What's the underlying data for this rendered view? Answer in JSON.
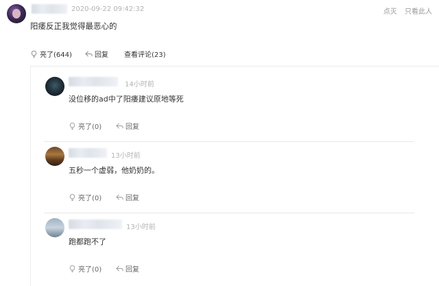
{
  "main_comment": {
    "time": "2020-09-22 09:42:32",
    "text": "阳痿反正我觉得最恶心的",
    "actions": {
      "like": "亮了(644)",
      "reply": "回复",
      "view_comments": "查看评论(23)"
    },
    "top_right": {
      "diss": "点灭",
      "only_this": "只看此人"
    }
  },
  "replies": [
    {
      "time": "14小时前",
      "text": "没位移的ad中了阳痿建议原地等死",
      "like": "亮了(0)",
      "reply": "回复"
    },
    {
      "time": "13小时前",
      "text": "五秒一个虚弱，他奶奶的。",
      "like": "亮了(0)",
      "reply": "回复"
    },
    {
      "time": "13小时前",
      "text": "跑都跑不了",
      "like": "亮了(0)",
      "reply": "回复"
    }
  ],
  "icons": [
    "lightbulb-icon",
    "reply-arrow-icon"
  ],
  "colors": {
    "time": "#b2b2b2",
    "text": "#333333",
    "action": "#666666"
  }
}
